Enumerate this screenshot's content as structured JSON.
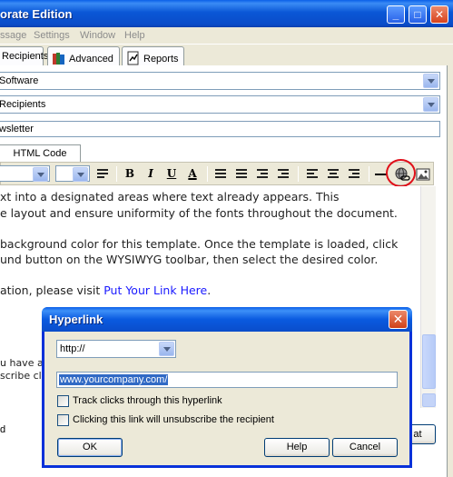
{
  "window": {
    "title": "orate Edition",
    "controls": {
      "minimize": "_",
      "maximize": "□",
      "close": "✕"
    }
  },
  "menu": [
    "ssage",
    "Settings",
    "Window",
    "Help"
  ],
  "tabs": [
    {
      "label": "Recipients",
      "icon": "recipients-icon"
    },
    {
      "label": "Advanced",
      "icon": "books-icon"
    },
    {
      "label": "Reports",
      "icon": "reports-icon"
    }
  ],
  "fields": {
    "sender": "Software",
    "recipients": "Recipients",
    "subject": "wsletter"
  },
  "editor_tabs": {
    "html_code": "HTML Code"
  },
  "toolbar": {
    "bold": "B",
    "italic": "I",
    "underline": "U",
    "font_color": "A",
    "hyperlink_icon": "hyperlink-globe-icon",
    "image_icon": "insert-image-icon"
  },
  "editor": {
    "lines": [
      "xt into a designated areas where text already appears. This",
      "e layout and ensure uniformity of the fonts throughout the document.",
      "",
      " background color for this template. Once the template is loaded, click",
      "und button on the WYSIWYG toolbar, then select the desired color.",
      "",
      "ation, please visit "
    ],
    "link_text": "Put Your Link Here",
    "link_suffix": ".",
    "partial_line_1": "u have ar",
    "partial_line_2": "scribe clic"
  },
  "bottom": {
    "left_text": "d",
    "right_button": "at"
  },
  "dialog": {
    "title": "Hyperlink",
    "protocol": "http://",
    "url": "www.yourcompany.com/",
    "track_clicks_label": "Track clicks through this hyperlink",
    "track_clicks_checked": false,
    "unsubscribe_label": "Clicking this link will unsubscribe the recipient",
    "unsubscribe_checked": false,
    "ok_label": "OK",
    "help_label": "Help",
    "cancel_label": "Cancel"
  },
  "colors": {
    "title_bar": "#0a57d6",
    "highlight_circle": "#e0101a",
    "link": "#1a1aff",
    "selection": "#316ac5"
  }
}
